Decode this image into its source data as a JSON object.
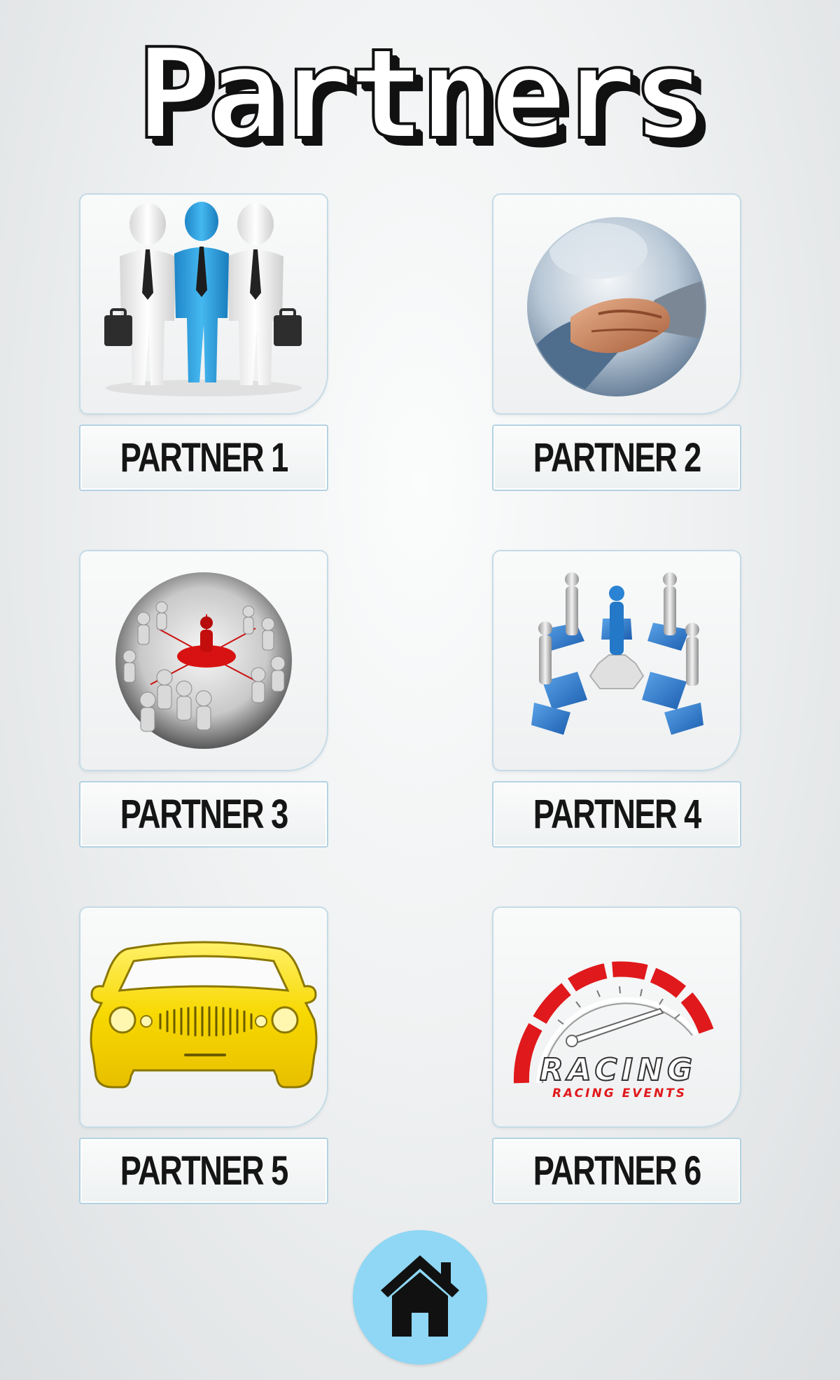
{
  "page": {
    "title": "Partners"
  },
  "partners": [
    {
      "label": "PARTNER 1",
      "icon": "business-team-icon"
    },
    {
      "label": "PARTNER 2",
      "icon": "handshake-icon"
    },
    {
      "label": "PARTNER 3",
      "icon": "network-crowd-icon"
    },
    {
      "label": "PARTNER 4",
      "icon": "puzzle-team-icon"
    },
    {
      "label": "PARTNER 5",
      "icon": "yellow-car-icon"
    },
    {
      "label": "PARTNER 6",
      "icon": "racing-speedometer-icon",
      "logo_text": "RACING",
      "logo_subtext": "RACING EVENTS"
    }
  ],
  "navigation": {
    "home_icon": "home-icon"
  },
  "colors": {
    "accent": "#8fd7f4",
    "border": "#b3d2e2",
    "text": "#151515",
    "blue_figure": "#2aa3e6",
    "car": "#f5d400",
    "racing_red": "#e0191c"
  }
}
